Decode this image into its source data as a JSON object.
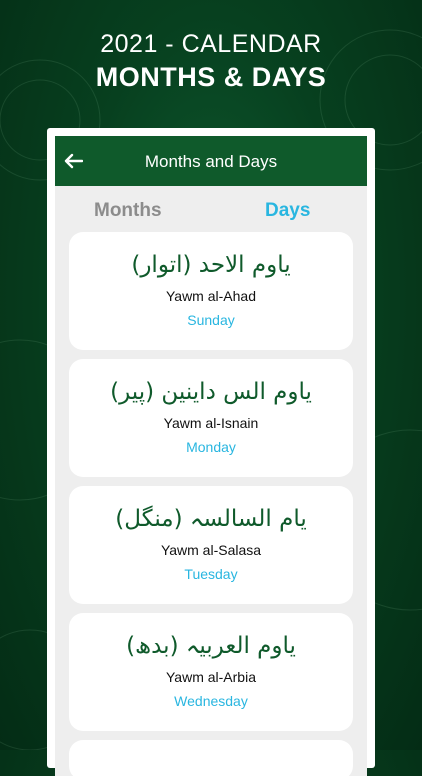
{
  "promo": {
    "line1": "2021 - CALENDAR",
    "line2": "MONTHS & DAYS"
  },
  "appbar": {
    "title": "Months and Days",
    "back_icon": "arrow-left-icon"
  },
  "tabs": [
    {
      "label": "Months",
      "active": false
    },
    {
      "label": "Days",
      "active": true
    }
  ],
  "days": [
    {
      "arabic": "ياوم الاحد (اتوار)",
      "translit": "Yawm al-Ahad",
      "english": "Sunday"
    },
    {
      "arabic": "ياوم الس داينين (پير)",
      "translit": "Yawm al-Isnain",
      "english": "Monday"
    },
    {
      "arabic": "يام السالسہ (منگل)",
      "translit": "Yawm al-Salasa",
      "english": "Tuesday"
    },
    {
      "arabic": "ياوم العربيہ (بدھ)",
      "translit": "Yawm al-Arbia",
      "english": "Wednesday"
    }
  ],
  "colors": {
    "green": "#0f5a2b",
    "accent_blue": "#29b6e0",
    "inactive_tab": "#8c8c8c"
  }
}
